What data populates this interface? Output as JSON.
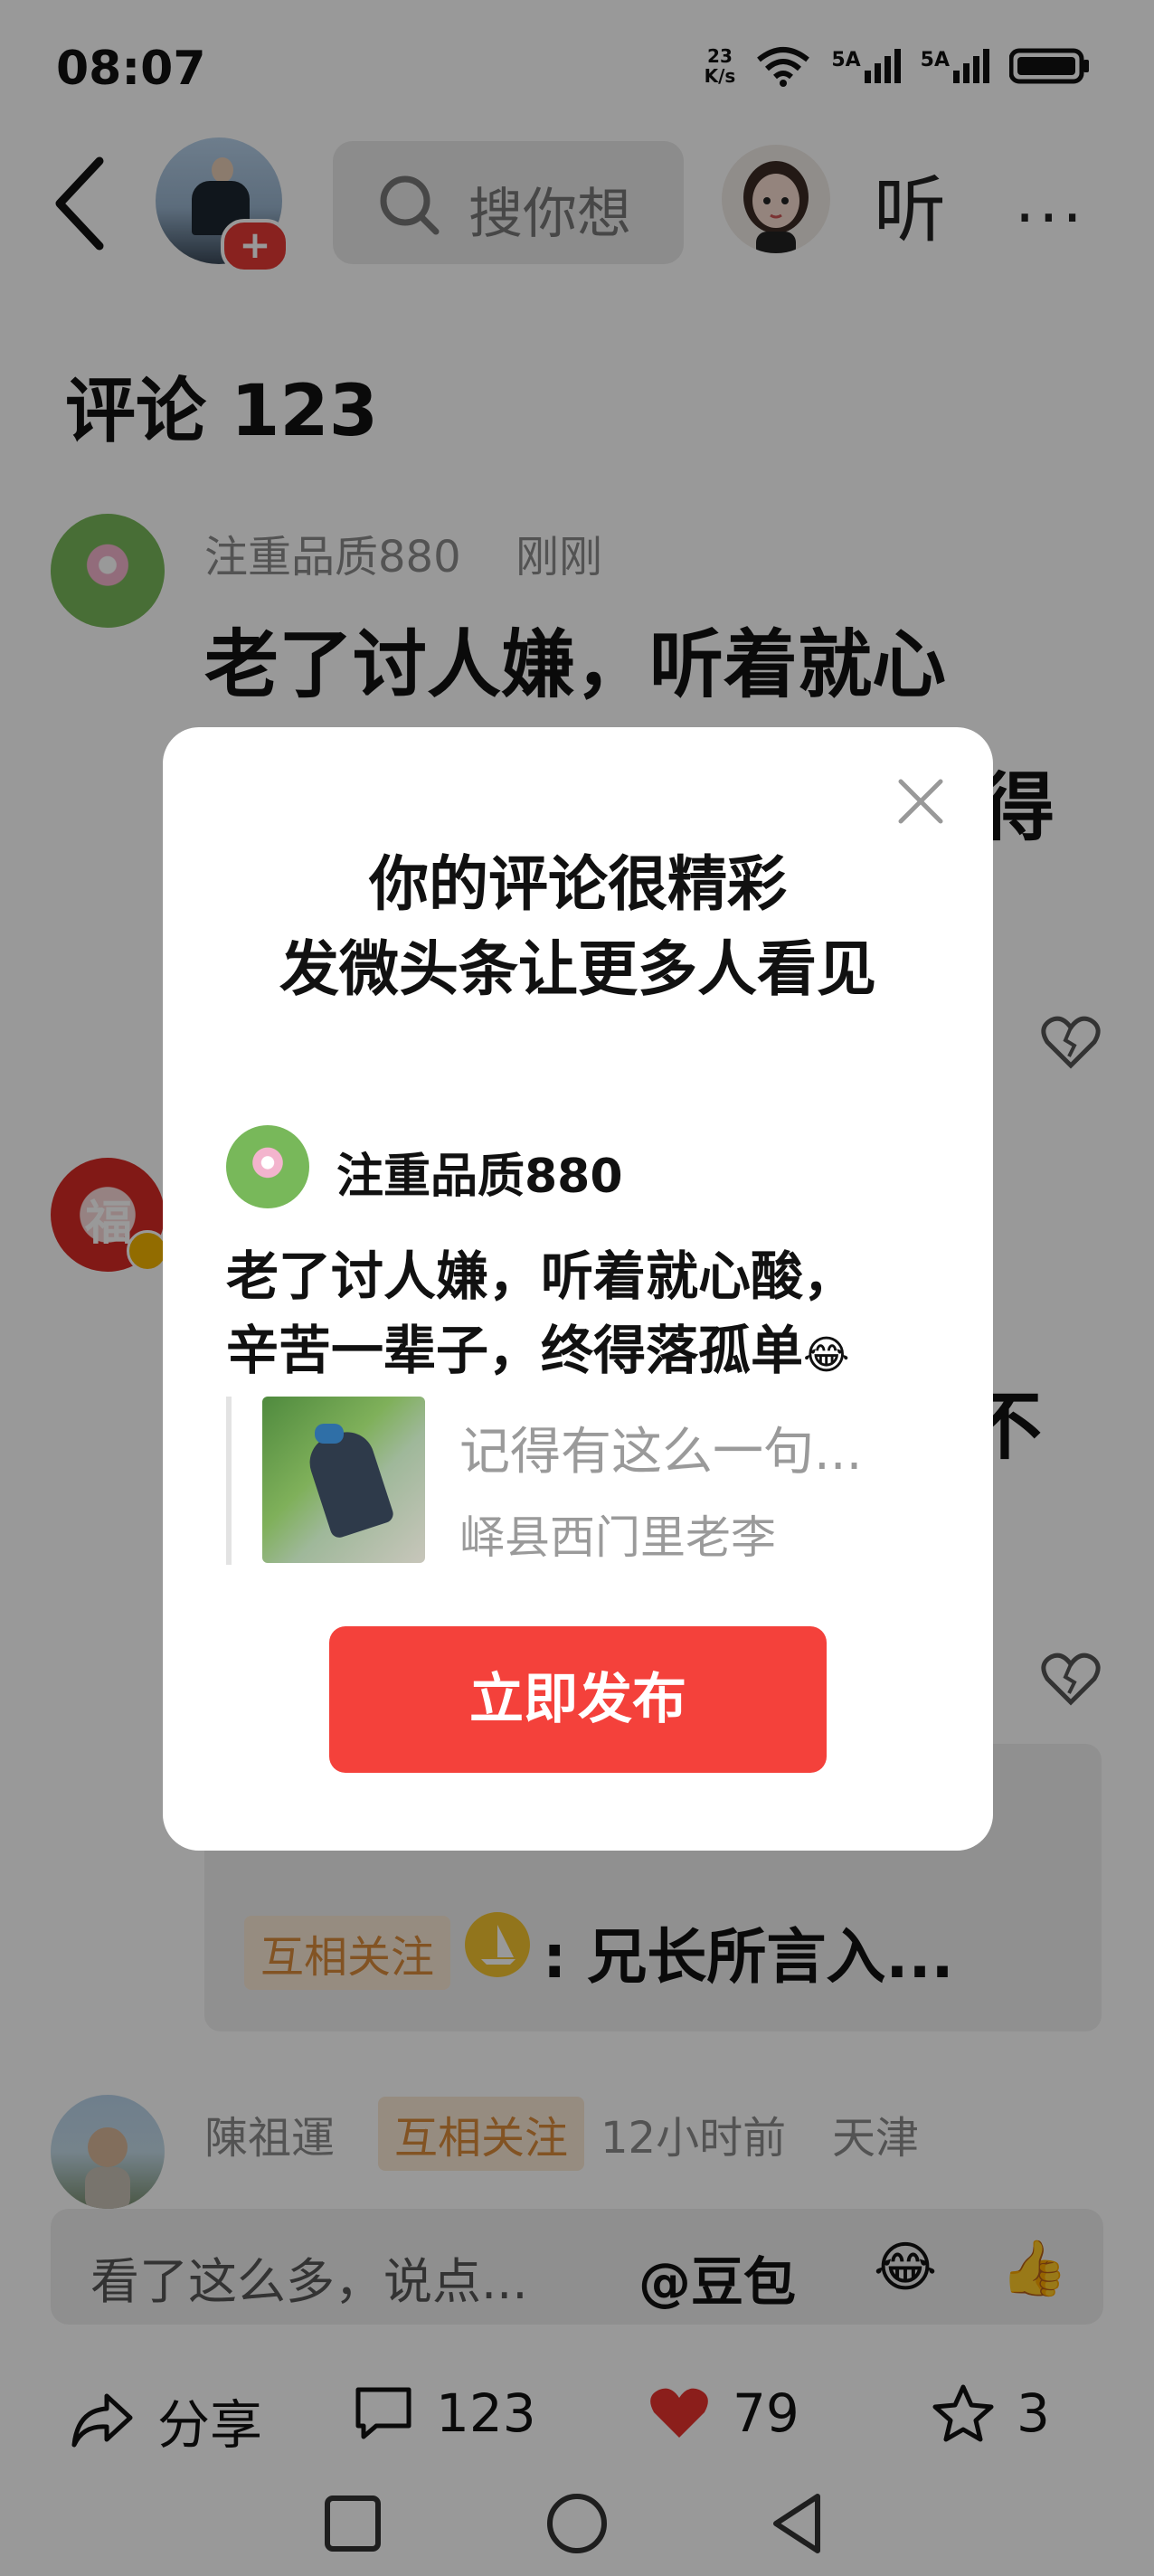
{
  "status_bar": {
    "time": "08:07",
    "net_speed_value": "23",
    "net_speed_unit": "K/s",
    "signal1": "5A",
    "signal2": "5A"
  },
  "top_nav": {
    "search_placeholder": "搜你想",
    "listen": "听",
    "more": "···",
    "follow_plus": "+"
  },
  "comments": {
    "title": "评论 123",
    "items": [
      {
        "user": "注重品质880",
        "time": "刚刚",
        "text_line1": "老了讨人嫌，听着就心",
        "text_line2_tail": "得"
      },
      {
        "avatar_char": "福",
        "text_tail": "不",
        "reply_tag": "互相关注",
        "reply_text": ": 兄长所言入..."
      },
      {
        "user": "陳祖運",
        "tag": "互相关注",
        "time": "12小时前",
        "location": "天津"
      }
    ]
  },
  "input_bar": {
    "placeholder": "看了这么多，说点...",
    "doubao": "@豆包",
    "emoji_laugh": "😂",
    "emoji_thumb": "👍"
  },
  "actions": {
    "share": "分享",
    "comment_count": "123",
    "like_count": "79",
    "fav_count": "3"
  },
  "dialog": {
    "title_line1": "你的评论很精彩",
    "title_line2": "发微头条让更多人看见",
    "user": "注重品质880",
    "comment_line1": "老了讨人嫌，听着就心酸，",
    "comment_line2": "辛苦一辈子，终得落孤单",
    "comment_emoji": "😂",
    "quote_title": "记得有这么一句...",
    "quote_author": "峄县西门里老李",
    "publish_button": "立即发布"
  }
}
